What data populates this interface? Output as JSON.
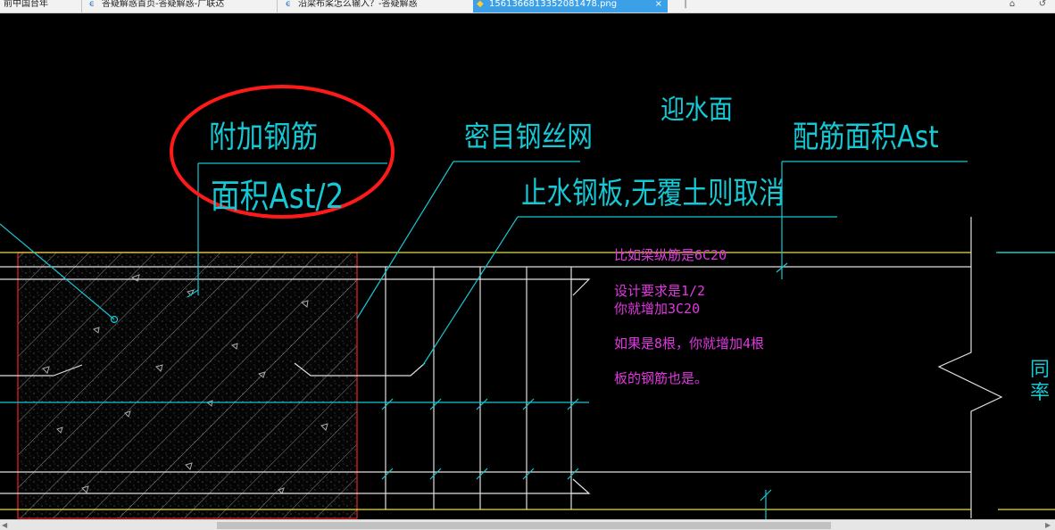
{
  "tabs": [
    {
      "label": "前中国台年",
      "icon": "document-icon",
      "active": false
    },
    {
      "label": "答疑解惑首页-答疑解惑-广联达",
      "icon": "glodon-logo-icon",
      "active": false
    },
    {
      "label": "沿梁布桨怎么输入？-答疑解惑",
      "icon": "glodon-logo-icon",
      "active": false
    },
    {
      "label": "1561366813352081478.png",
      "icon": "image-file-icon",
      "active": true
    }
  ],
  "tab_close_glyph": "×",
  "new_tab_glyph": "|",
  "window_controls": {
    "icon1": "home-icon",
    "icon2": "undo-icon"
  },
  "drawing": {
    "labels": {
      "extra_rebar": "附加钢筋",
      "area_half": "面积Ast/2",
      "mesh": "密目钢丝网",
      "water_face": "迎水面",
      "rebar_area": "配筋面积Ast",
      "waterstop": "止水钢板,无覆土则取消",
      "right_edge_1": "同",
      "right_edge_2": "率"
    },
    "colors": {
      "cyan": "#15c8d4",
      "yellow": "#e8e040",
      "red": "#e02020",
      "magenta": "#e238e2",
      "white": "#e0e0e0"
    }
  },
  "notes": [
    "比如梁纵筋是6C20",
    "设计要求是1/2",
    "你就增加3C20",
    "如果是8根，你就增加4根",
    "板的钢筋也是。"
  ]
}
